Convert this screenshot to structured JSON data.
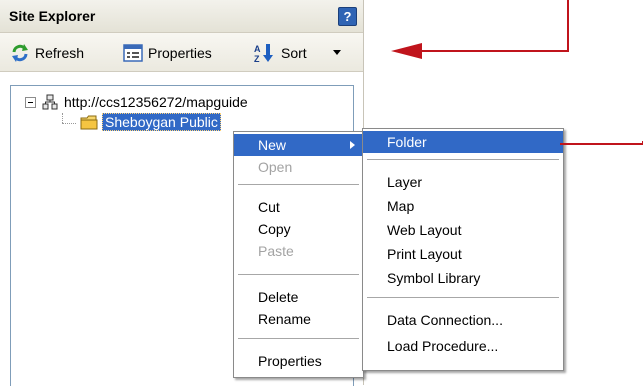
{
  "panel": {
    "title": "Site Explorer",
    "help_icon": "question-mark-icon"
  },
  "toolbar": {
    "refresh_label": "Refresh",
    "properties_label": "Properties",
    "sort_label": "Sort"
  },
  "tree": {
    "root_label": "http://ccs12356272/mapguide",
    "folder_label": "Sheboygan Public"
  },
  "context_menu": {
    "items": [
      {
        "label": "New",
        "enabled": true,
        "highlight": true,
        "submenu": true
      },
      {
        "label": "Open",
        "enabled": false
      },
      {
        "label": "Cut",
        "enabled": true
      },
      {
        "label": "Copy",
        "enabled": true
      },
      {
        "label": "Paste",
        "enabled": false
      },
      {
        "label": "Delete",
        "enabled": true
      },
      {
        "label": "Rename",
        "enabled": true
      },
      {
        "label": "Properties",
        "enabled": true
      }
    ]
  },
  "submenu": {
    "items": [
      {
        "label": "Folder",
        "highlight": true
      },
      {
        "label": "Layer"
      },
      {
        "label": "Map"
      },
      {
        "label": "Web Layout"
      },
      {
        "label": "Print Layout"
      },
      {
        "label": "Symbol Library"
      },
      {
        "label": "Data Connection..."
      },
      {
        "label": "Load Procedure..."
      }
    ]
  },
  "colors": {
    "selection": "#3169c6",
    "annotation_arrow": "#c0141c"
  }
}
